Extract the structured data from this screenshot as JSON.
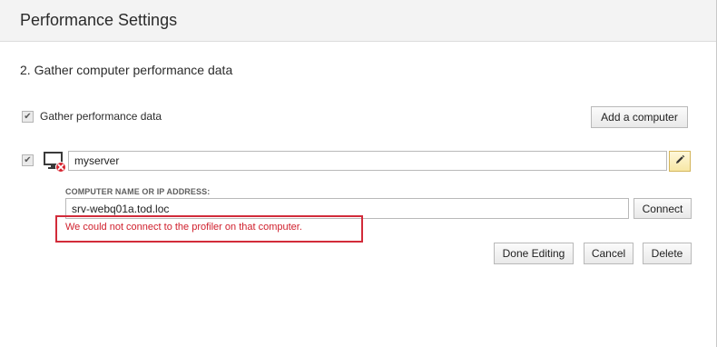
{
  "window": {
    "title": "Performance Settings"
  },
  "section": {
    "heading": "2. Gather computer performance data"
  },
  "gather": {
    "label": "Gather performance data",
    "checked": true
  },
  "toolbar": {
    "add_computer_label": "Add a computer"
  },
  "computer": {
    "checked": true,
    "name": "myserver",
    "status_icon": "computer-error-icon",
    "edit_icon": "pencil-icon"
  },
  "editor": {
    "field_label": "COMPUTER NAME OR IP ADDRESS:",
    "address_value": "srv-webq01a.tod.loc",
    "connect_label": "Connect",
    "error_message": "We could not connect to the profiler on that computer.",
    "done_label": "Done Editing",
    "cancel_label": "Cancel",
    "delete_label": "Delete"
  },
  "colors": {
    "error": "#d0202d",
    "edit_button_bg": "#f7e7a5",
    "titlebar_bg": "#f3f3f3"
  }
}
